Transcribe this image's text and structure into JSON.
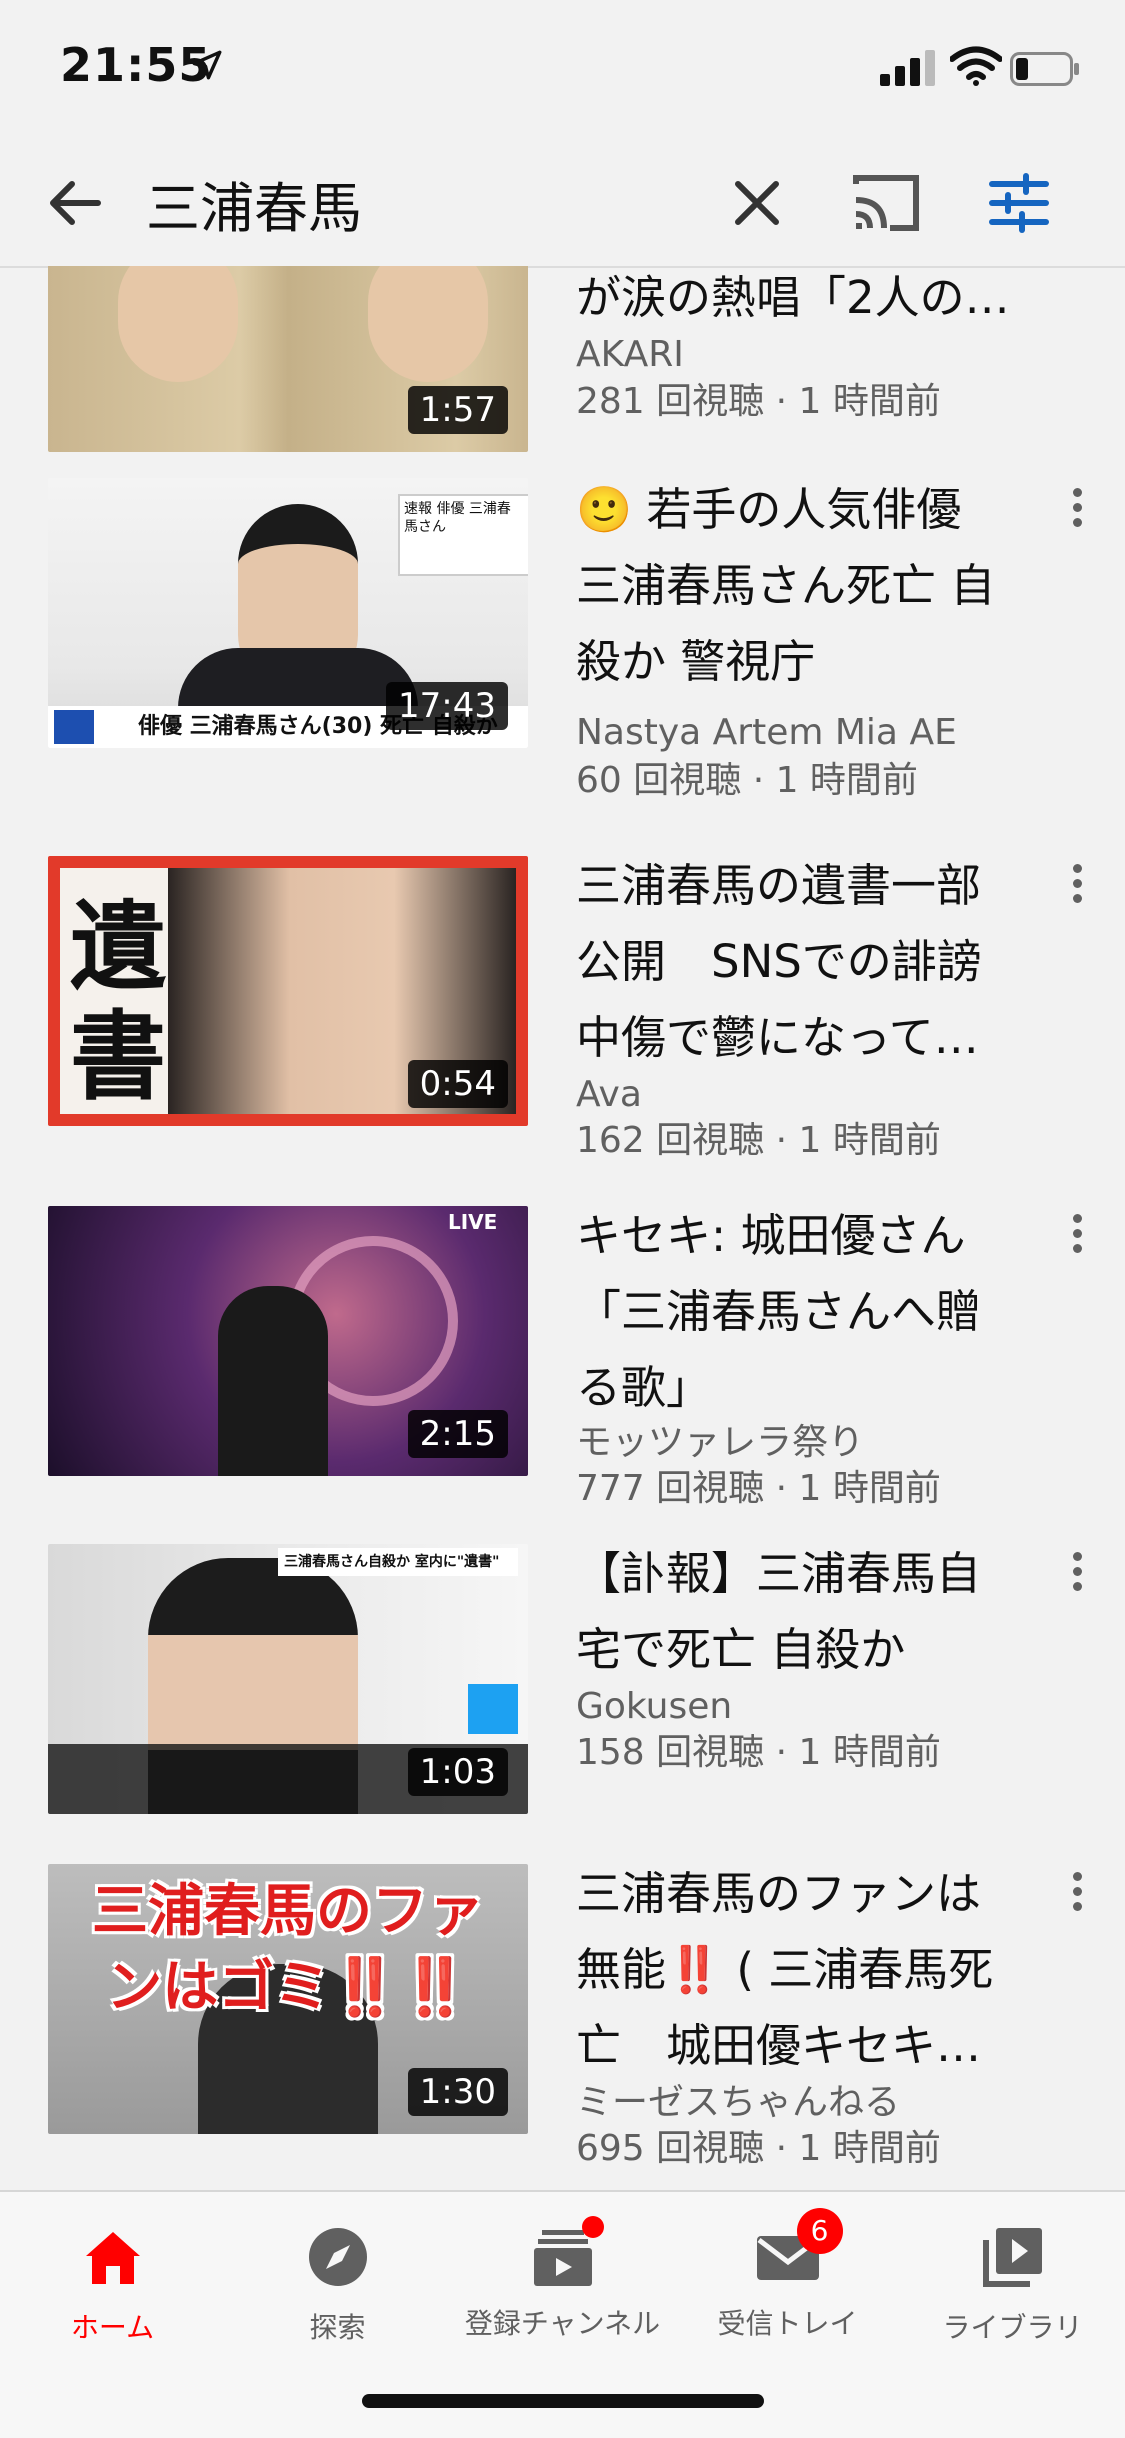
{
  "status": {
    "time": "21:55"
  },
  "search": {
    "query": "三浦春馬"
  },
  "videos": [
    {
      "title_lines": [
        "が涙の熱唱「2人の…"
      ],
      "channel": "AKARI",
      "meta": "281 回視聴 · 1 時間前",
      "duration": "1:57"
    },
    {
      "title_lines": [
        "🙂 若手の人気俳優",
        "三浦春馬さん死亡 自",
        "殺か 警視庁"
      ],
      "channel": "Nastya Artem Mia AE",
      "meta": "60 回視聴 · 1 時間前",
      "duration": "17:43",
      "thumb_text": "俳優 三浦春馬さん(30) 死亡 自殺か"
    },
    {
      "title_lines": [
        "三浦春馬の遺書一部",
        "公開　SNSでの誹謗",
        "中傷で鬱になって…"
      ],
      "channel": "Ava",
      "meta": "162 回視聴 · 1 時間前",
      "duration": "0:54",
      "thumb_text": "遺書"
    },
    {
      "title_lines": [
        "キセキ: 城田優さん",
        "「三浦春馬さんへ贈",
        "る歌」"
      ],
      "channel": "モッツァレラ祭り",
      "meta": "777 回視聴 · 1 時間前",
      "duration": "2:15",
      "thumb_text": "LIVE"
    },
    {
      "title_lines": [
        "【訃報】三浦春馬自",
        "宅で死亡 自殺か"
      ],
      "channel": "Gokusen",
      "meta": "158 回視聴 · 1 時間前",
      "duration": "1:03",
      "thumb_text": "三浦春馬さん自殺か 室内に\"遺書\""
    },
    {
      "title_lines": [
        "三浦春馬のファンは",
        "無能‼️ ( 三浦春馬死",
        "亡　城田優キセキ…"
      ],
      "channel": "ミーゼスちゃんねる",
      "meta": "695 回視聴 · 1 時間前",
      "duration": "1:30",
      "thumb_text": "三浦春馬のファンはゴミ‼️‼️"
    }
  ],
  "nav": {
    "home": "ホーム",
    "explore": "探索",
    "subscriptions": "登録チャンネル",
    "inbox": "受信トレイ",
    "inbox_badge": "6",
    "library": "ライブラリ"
  },
  "colors": {
    "accent": "#ff0000",
    "nav_active": "#ff0000",
    "filter_icon": "#1565c0"
  }
}
